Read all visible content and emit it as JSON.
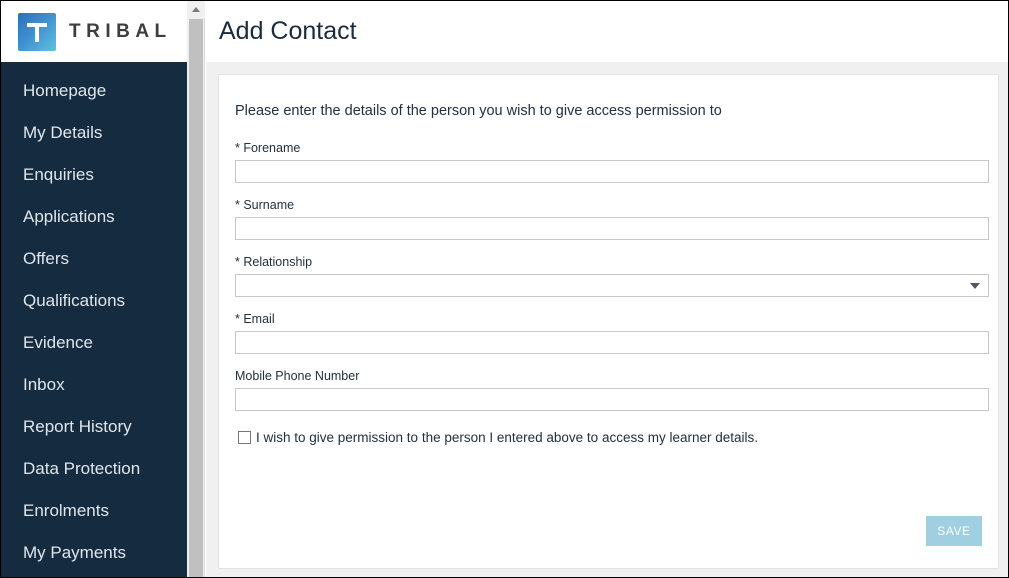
{
  "brand": {
    "logo_letter": "T",
    "name": "TRIBAL",
    "logo_icon": "tribal-t-logo-icon"
  },
  "sidebar": {
    "items": [
      {
        "label": "Homepage"
      },
      {
        "label": "My Details"
      },
      {
        "label": "Enquiries"
      },
      {
        "label": "Applications"
      },
      {
        "label": "Offers"
      },
      {
        "label": "Qualifications"
      },
      {
        "label": "Evidence"
      },
      {
        "label": "Inbox"
      },
      {
        "label": "Report History"
      },
      {
        "label": "Data Protection"
      },
      {
        "label": "Enrolments"
      },
      {
        "label": "My Payments"
      }
    ],
    "scrollbar": {
      "up_arrow_icon": "chevron-up-icon"
    }
  },
  "header": {
    "title": "Add Contact"
  },
  "form": {
    "intro": "Please enter the details of the person you wish to give access permission to",
    "fields": [
      {
        "label": "* Forename",
        "value": "",
        "placeholder": "",
        "type": "text"
      },
      {
        "label": "* Surname",
        "value": "",
        "placeholder": "",
        "type": "text"
      },
      {
        "label": "* Relationship",
        "value": "",
        "placeholder": "",
        "type": "select",
        "options": [
          ""
        ]
      },
      {
        "label": "* Email",
        "value": "",
        "placeholder": "",
        "type": "text"
      },
      {
        "label": "Mobile Phone Number",
        "value": "",
        "placeholder": "",
        "type": "text"
      }
    ],
    "consent": {
      "label": "I wish to give permission to the person I entered above to access my learner details.",
      "checked": false
    },
    "save_label": "SAVE"
  },
  "colors": {
    "sidebar_bg": "#152b40",
    "sidebar_text": "#dfe6ec",
    "page_bg": "#f0f0f0",
    "card_bg": "#ffffff",
    "title_text": "#1b2b3d",
    "save_button_bg": "#9fcfe0",
    "input_border": "#c8c8c8"
  }
}
